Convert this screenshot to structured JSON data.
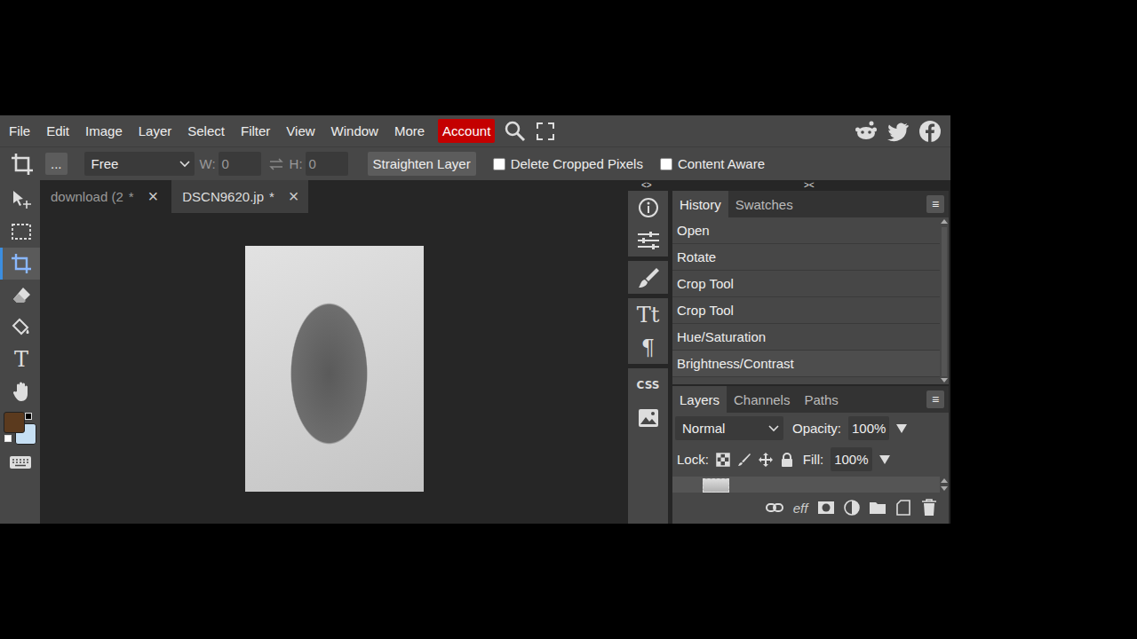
{
  "menu": [
    "File",
    "Edit",
    "Image",
    "Layer",
    "Select",
    "Filter",
    "View",
    "Window",
    "More"
  ],
  "account": "Account",
  "options": {
    "more": "...",
    "mode": "Free",
    "w_label": "W:",
    "w": "0",
    "h_label": "H:",
    "h": "0",
    "straighten": "Straighten Layer",
    "checks": [
      {
        "label": "Delete Cropped Pixels",
        "checked": false
      },
      {
        "label": "Content Aware",
        "checked": false
      }
    ]
  },
  "tools": [
    {
      "kind": "move",
      "selected": false
    },
    {
      "kind": "marquee",
      "selected": false
    },
    {
      "kind": "crop",
      "selected": true
    },
    {
      "kind": "eraser",
      "selected": false
    },
    {
      "kind": "fill",
      "selected": false
    },
    {
      "kind": "text",
      "glyph": "T",
      "selected": false
    },
    {
      "kind": "hand",
      "selected": false
    }
  ],
  "colors": {
    "foreground": "#5b3a1e",
    "background": "#c6dff3"
  },
  "documents": [
    {
      "label": "download (2",
      "modified": "*",
      "close": "×",
      "selected": false
    },
    {
      "label": "DSCN9620.jp",
      "modified": "*",
      "close": "×",
      "selected": true
    }
  ],
  "panel_toggles": [
    "<>",
    "><"
  ],
  "dock": [
    {
      "kind": "info"
    },
    {
      "kind": "adjust"
    },
    {
      "kind": "brush"
    },
    {
      "kind": "text",
      "glyph": "Tt"
    },
    {
      "kind": "text",
      "glyph": "¶"
    },
    {
      "kind": "text",
      "glyph": "CSS"
    },
    {
      "kind": "image"
    }
  ],
  "history": {
    "tabs": [
      {
        "label": "History",
        "selected": true
      },
      {
        "label": "Swatches",
        "selected": false
      }
    ],
    "menu": "≡",
    "items": [
      {
        "label": "Open",
        "selected": false
      },
      {
        "label": "Rotate",
        "selected": false
      },
      {
        "label": "Crop Tool",
        "selected": false
      },
      {
        "label": "Crop Tool",
        "selected": false
      },
      {
        "label": "Hue/Saturation",
        "selected": false
      },
      {
        "label": "Brightness/Contrast",
        "selected": true
      }
    ]
  },
  "layers": {
    "tabs": [
      {
        "label": "Layers",
        "selected": true
      },
      {
        "label": "Channels",
        "selected": false
      },
      {
        "label": "Paths",
        "selected": false
      }
    ],
    "menu": "≡",
    "blend": "Normal",
    "opacity_label": "Opacity:",
    "opacity": "100%",
    "lock_label": "Lock:",
    "fill_label": "Fill:",
    "fill": "100%",
    "footer": [
      {
        "kind": "link"
      },
      {
        "kind": "text",
        "glyph": "eff"
      },
      {
        "kind": "mask"
      },
      {
        "kind": "adjustment"
      },
      {
        "kind": "folder"
      },
      {
        "kind": "new"
      },
      {
        "kind": "trash"
      }
    ]
  }
}
